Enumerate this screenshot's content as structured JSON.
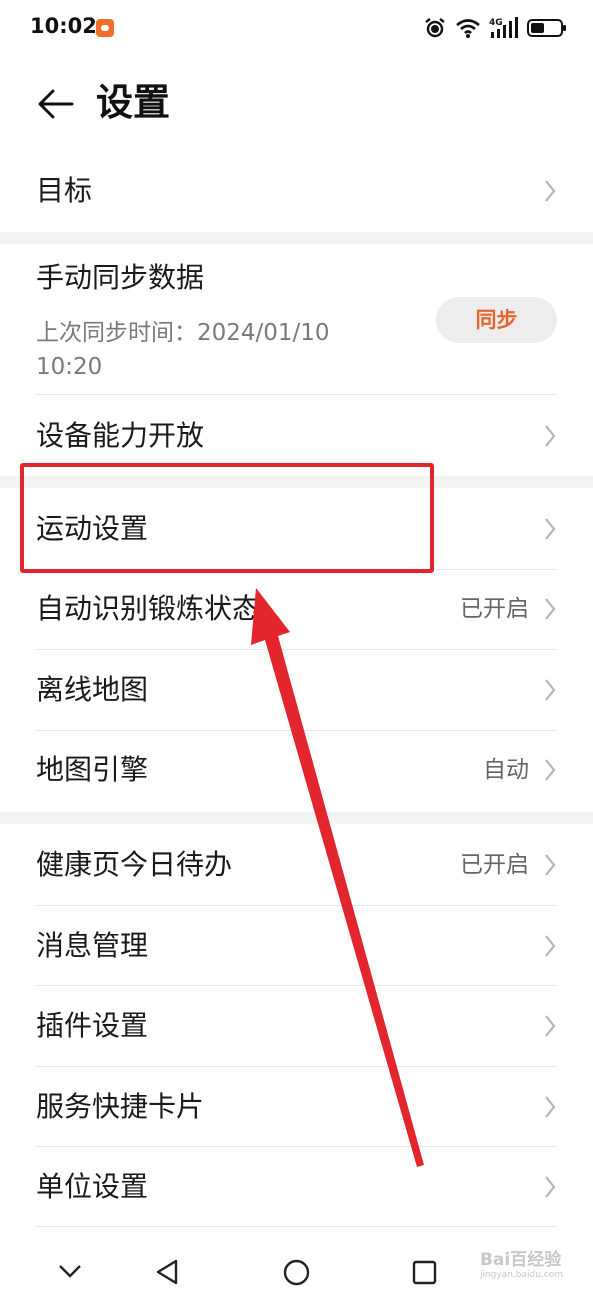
{
  "status_bar": {
    "time": "10:02",
    "network": "4G"
  },
  "header": {
    "title": "设置"
  },
  "section1": {
    "goal_label": "目标"
  },
  "section2": {
    "sync_title": "手动同步数据",
    "sync_subtitle": "上次同步时间：2024/01/10 10:20",
    "sync_button": "同步",
    "device_label": "设备能力开放"
  },
  "section3": {
    "sport_settings": "运动设置",
    "auto_detect": {
      "label": "自动识别锻炼状态",
      "value": "已开启"
    },
    "offline_map": "离线地图",
    "map_engine": {
      "label": "地图引擎",
      "value": "自动"
    }
  },
  "section4": {
    "health_todo": {
      "label": "健康页今日待办",
      "value": "已开启"
    },
    "message_mgmt": "消息管理",
    "plugin_settings": "插件设置",
    "service_cards": "服务快捷卡片",
    "unit_settings": "单位设置"
  },
  "watermark": {
    "main": "Bai百经验",
    "sub": "jingyan.baidu.com"
  },
  "colors": {
    "accent": "#e8642c",
    "annotation_red": "#e3262d"
  }
}
